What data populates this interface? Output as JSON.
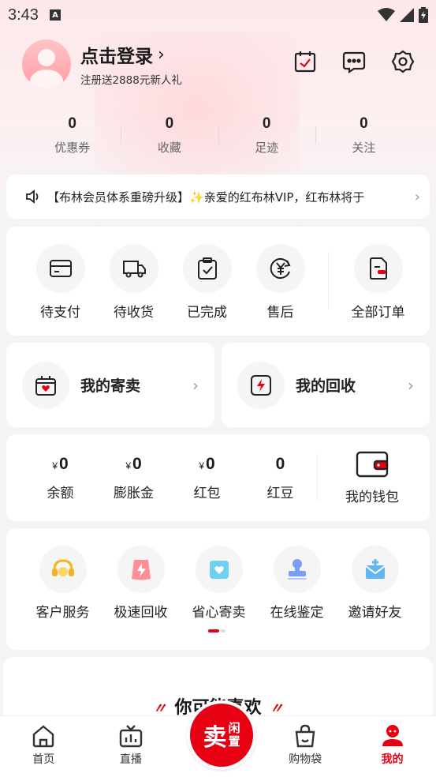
{
  "status_bar": {
    "time": "3:43",
    "indicator": "A"
  },
  "header": {
    "login_title": "点击登录",
    "login_subtitle": "注册送2888元新人礼",
    "icons": [
      "checkin-calendar-icon",
      "message-icon",
      "settings-icon"
    ]
  },
  "stats": [
    {
      "value": "0",
      "label": "优惠券"
    },
    {
      "value": "0",
      "label": "收藏"
    },
    {
      "value": "0",
      "label": "足迹"
    },
    {
      "value": "0",
      "label": "关注"
    }
  ],
  "notice": {
    "text_a": "【布林会员体系重磅升级】",
    "text_b": "亲爱的红布林VIP，红布林将于"
  },
  "orders": {
    "items": [
      {
        "label": "待支付",
        "icon": "card-icon"
      },
      {
        "label": "待收货",
        "icon": "truck-icon"
      },
      {
        "label": "已完成",
        "icon": "clipboard-check-icon"
      },
      {
        "label": "售后",
        "icon": "yuan-refund-icon"
      }
    ],
    "all_label": "全部订单"
  },
  "consign": {
    "title": "我的寄卖"
  },
  "recycle": {
    "title": "我的回收"
  },
  "wallet": {
    "currency": "¥",
    "items": [
      {
        "value": "0",
        "label": "余额",
        "currency": true
      },
      {
        "value": "0",
        "label": "膨胀金",
        "currency": true
      },
      {
        "value": "0",
        "label": "红包",
        "currency": true
      },
      {
        "value": "0",
        "label": "红豆",
        "currency": false
      }
    ],
    "purse_label": "我的钱包"
  },
  "services": [
    {
      "label": "客户服务",
      "icon": "headset-icon"
    },
    {
      "label": "极速回收",
      "icon": "lightning-icon"
    },
    {
      "label": "省心寄卖",
      "icon": "heart-bag-icon"
    },
    {
      "label": "在线鉴定",
      "icon": "stamp-icon"
    },
    {
      "label": "邀请好友",
      "icon": "invite-mail-icon"
    }
  ],
  "guess": {
    "title": "你可能喜欢"
  },
  "tabbar": {
    "home": "首页",
    "live": "直播",
    "sell_big": "卖",
    "sell_small_1": "闲",
    "sell_small_2": "置",
    "bag": "购物袋",
    "mine": "我的"
  },
  "colors": {
    "accent": "#e60012",
    "background": "#f4f4f6"
  }
}
